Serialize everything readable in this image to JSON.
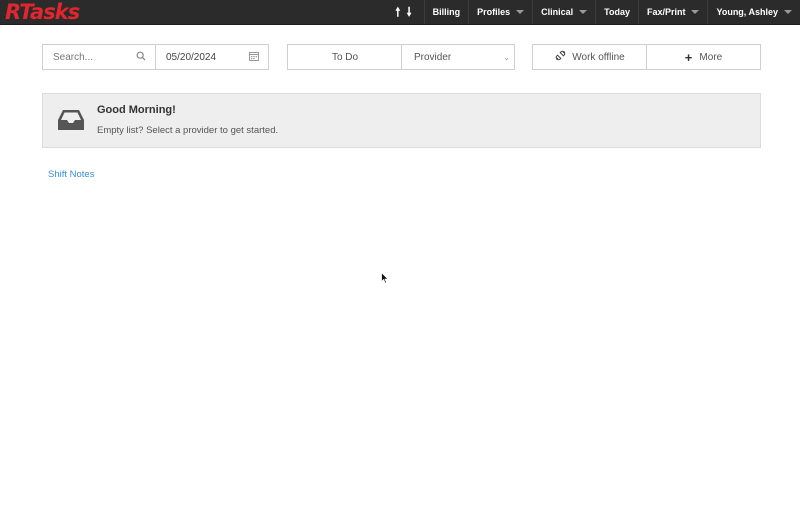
{
  "app": {
    "logo": "RTasks"
  },
  "nav": {
    "arrow_up": "🠕",
    "arrow_down": "🠗",
    "items": [
      {
        "label": "Billing",
        "has_caret": false
      },
      {
        "label": "Profiles",
        "has_caret": true
      },
      {
        "label": "Clinical",
        "has_caret": true
      },
      {
        "label": "Today",
        "has_caret": false
      },
      {
        "label": "Fax/Print",
        "has_caret": true
      },
      {
        "label": "Young, Ashley",
        "has_caret": true
      }
    ]
  },
  "toolbar": {
    "search_placeholder": "Search...",
    "date_value": "05/20/2024",
    "todo_label": "To Do",
    "provider_value": "Provider",
    "offline_label": "Work offline",
    "more_label": "More"
  },
  "panel": {
    "greeting": "Good Morning!",
    "message": "Empty list? Select a provider to get started."
  },
  "links": {
    "shift_notes": "Shift Notes"
  },
  "colors": {
    "topbar": "#2b2b2b",
    "logo": "#e0262e",
    "link": "#3a8fd6",
    "panel": "#eeeeee"
  }
}
